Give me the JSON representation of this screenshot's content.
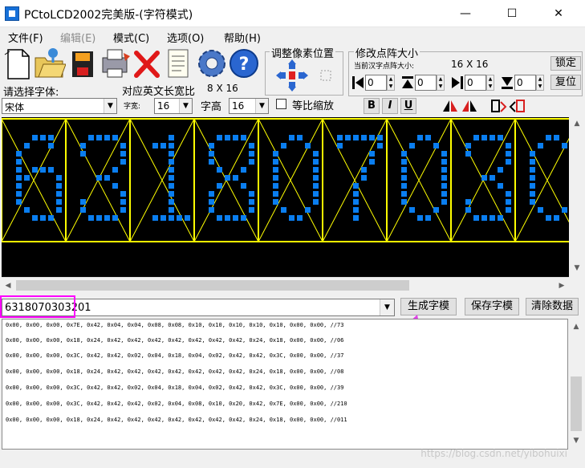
{
  "window": {
    "title": "PCtoLCD2002完美版-(字符模式)",
    "minimize": "—",
    "maximize": "☐",
    "close": "✕"
  },
  "menu": [
    "文件(F)",
    "编辑(E)",
    "模式(C)",
    "选项(O)",
    "帮助(H)"
  ],
  "toolbar_icons": [
    "new-file-icon",
    "open-folder-icon",
    "save-disk-icon",
    "print-icon",
    "delete-icon",
    "notes-icon",
    "settings-gear-icon",
    "help-icon"
  ],
  "pixel_group": {
    "title": "调整像素位置"
  },
  "size_group": {
    "title": "修改点阵大小",
    "current_label": "当前汉字点阵大小:",
    "current_value": "16 X 16",
    "lock_button": "锁定",
    "restore_button": "复位",
    "spinners": [
      "0",
      "0",
      "0",
      "0"
    ]
  },
  "font": {
    "select_label": "请选择字体:",
    "font_value": "宋体",
    "ratio_label": "对应英文长宽比",
    "ratio_value": "8 X 16",
    "width_label": "字宽:",
    "width_value": "16",
    "height_label": "字高",
    "height_value": "16",
    "proportional_label": "等比缩放",
    "bold": "B",
    "italic": "I",
    "underline": "U"
  },
  "led": {
    "chars": [
      "6",
      "3",
      "1",
      "8",
      "0",
      "7",
      "0",
      "3",
      "0"
    ],
    "color": "#0a7ef0",
    "grid_color": "#ffff00"
  },
  "input": {
    "value": "6318070303201"
  },
  "buttons": {
    "generate": "生成字模",
    "save": "保存字模",
    "clear": "清除数据"
  },
  "output_lines": [
    "0x00, 0x00, 0x00, 0x7E, 0x42, 0x04, 0x04, 0x08, 0x08, 0x10, 0x10, 0x10, 0x10, 0x10, 0x00, 0x00, //73",
    "0x00, 0x00, 0x00, 0x18, 0x24, 0x42, 0x42, 0x42, 0x42, 0x42, 0x42, 0x42, 0x24, 0x18, 0x00, 0x00, //06",
    "0x00, 0x00, 0x00, 0x3C, 0x42, 0x42, 0x02, 0x04, 0x18, 0x04, 0x02, 0x42, 0x42, 0x3C, 0x00, 0x00, //37",
    "0x00, 0x00, 0x00, 0x18, 0x24, 0x42, 0x42, 0x42, 0x42, 0x42, 0x42, 0x42, 0x24, 0x18, 0x00, 0x00, //08",
    "0x00, 0x00, 0x00, 0x3C, 0x42, 0x42, 0x02, 0x04, 0x18, 0x04, 0x02, 0x42, 0x42, 0x3C, 0x00, 0x00, //39",
    "0x00, 0x00, 0x00, 0x3C, 0x42, 0x42, 0x42, 0x02, 0x04, 0x08, 0x10, 0x20, 0x42, 0x7E, 0x00, 0x00, //210",
    "0x00, 0x00, 0x00, 0x18, 0x24, 0x42, 0x42, 0x42, 0x42, 0x42, 0x42, 0x42, 0x24, 0x18, 0x00, 0x00, //011"
  ],
  "watermark": "https://blog.csdn.net/yibohuixi"
}
